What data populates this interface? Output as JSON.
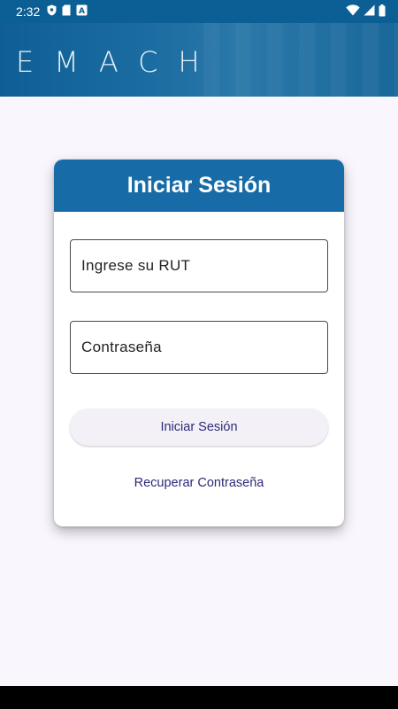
{
  "status_bar": {
    "time": "2:32",
    "left_icons": [
      "shield-icon",
      "sd-card-icon",
      "a-box-icon"
    ],
    "right_icons": [
      "wifi-icon",
      "signal-icon",
      "battery-icon"
    ]
  },
  "header": {
    "logo_text": "EMACH",
    "background_color": "#1a6ba0"
  },
  "login_card": {
    "title": "Iniciar Sesión",
    "rut_placeholder": "Ingrese su RUT",
    "rut_value": "",
    "password_placeholder": "Contraseña",
    "password_value": "",
    "login_button_label": "Iniciar Sesión",
    "recover_link_label": "Recuperar Contraseña",
    "header_color": "#176ca8",
    "accent_text_color": "#2e2a7a"
  }
}
